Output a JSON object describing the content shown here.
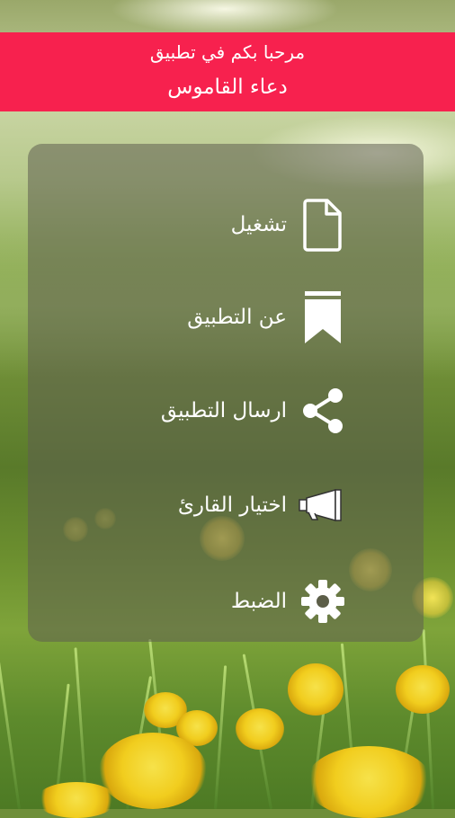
{
  "header": {
    "welcome": "مرحبا بكم في تطبيق",
    "app_name": "دعاء القاموس",
    "background_color": "#f7214e"
  },
  "menu": {
    "items": [
      {
        "label": "تشغيل",
        "icon": "document-icon"
      },
      {
        "label": "عن التطبيق",
        "icon": "bookmark-icon"
      },
      {
        "label": "ارسال التطبيق",
        "icon": "share-icon"
      },
      {
        "label": "اختيار القارئ",
        "icon": "megaphone-icon"
      },
      {
        "label": "الضبط",
        "icon": "gear-icon"
      }
    ]
  }
}
